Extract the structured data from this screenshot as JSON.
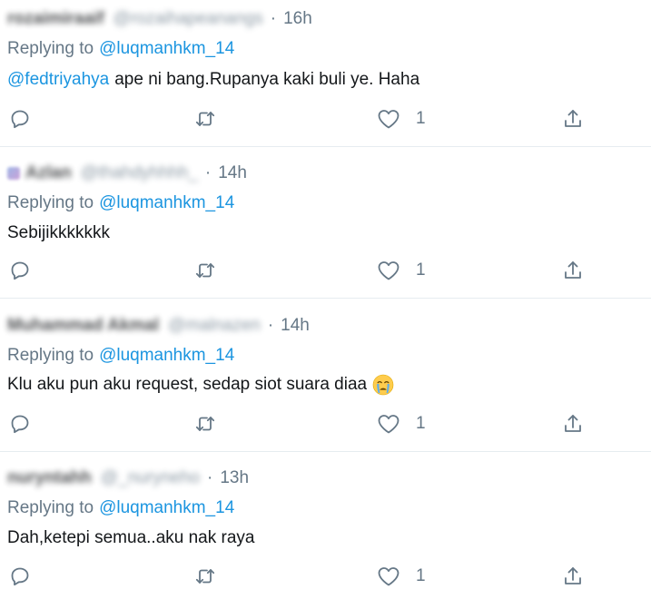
{
  "replying_prefix": "Replying to",
  "replying_to": "@luqmanhkm_14",
  "separator": "·",
  "colors": {
    "link": "#1b95e0",
    "muted": "#657786",
    "text": "#14171a",
    "divider": "#e6ecf0"
  },
  "icons": {
    "reply": "reply-icon",
    "retweet": "retweet-icon",
    "like": "heart-icon",
    "share": "share-icon",
    "emoji": "loudly-crying-face-emoji"
  },
  "tweets": [
    {
      "name": "rozaimiraaif",
      "handle": "@rozaihapeanangs",
      "time": "16h",
      "mention": "@fedtriyahya",
      "text": "ape ni bang.Rupanya kaki buli ye. Haha",
      "likes": "1"
    },
    {
      "name": "Azlan",
      "handle": "@thahdyhhhh_",
      "time": "14h",
      "text": "Sebijikkkkkkk",
      "likes": "1"
    },
    {
      "name": "Muhammad Akmal",
      "handle": "@malnazen",
      "time": "14h",
      "text": "Klu aku pun aku request, sedap siot suara diaa",
      "likes": "1"
    },
    {
      "name": "nuryntahh",
      "handle": "@_nuryneho",
      "time": "13h",
      "text": "Dah,ketepi semua..aku nak raya",
      "likes": "1"
    }
  ]
}
